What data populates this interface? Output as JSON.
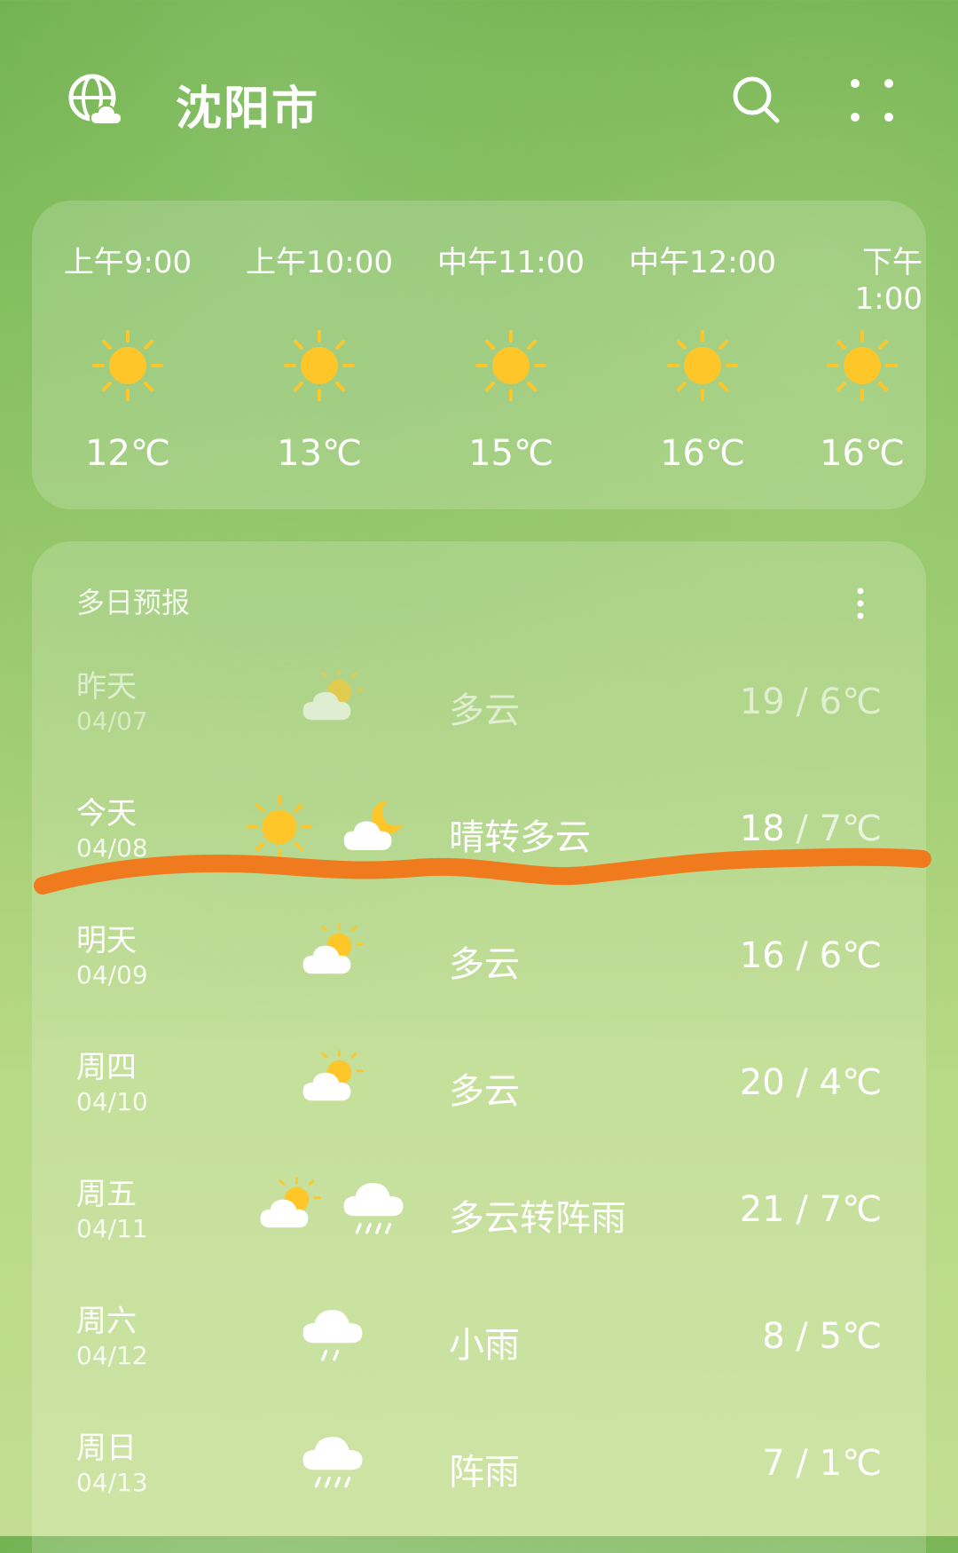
{
  "header": {
    "city": "沈阳市",
    "icons": {
      "left": "globe-cloud-icon",
      "search": "search-icon",
      "more": "more-dots-icon"
    }
  },
  "hourly": [
    {
      "time": "上午9:00",
      "temp": "12℃",
      "icon": "sun-icon"
    },
    {
      "time": "上午10:00",
      "temp": "13℃",
      "icon": "sun-icon"
    },
    {
      "time": "中午11:00",
      "temp": "15℃",
      "icon": "sun-icon"
    },
    {
      "time": "中午12:00",
      "temp": "16℃",
      "icon": "sun-icon"
    },
    {
      "time": "下午1:00",
      "temp": "16℃",
      "icon": "sun-icon"
    }
  ],
  "daily": {
    "title": "多日预报",
    "items": [
      {
        "day": "昨天",
        "date": "04/07",
        "condition": "多云",
        "temp_hi": "19",
        "temp_lo": "6℃",
        "icons": [
          "partly-cloudy-icon"
        ]
      },
      {
        "day": "今天",
        "date": "04/08",
        "condition": "晴转多云",
        "temp_hi": "18",
        "temp_lo": "7℃",
        "icons": [
          "sun-icon",
          "cloud-moon-icon"
        ]
      },
      {
        "day": "明天",
        "date": "04/09",
        "condition": "多云",
        "temp_hi": "16",
        "temp_lo": "6℃",
        "icons": [
          "partly-cloudy-icon"
        ]
      },
      {
        "day": "周四",
        "date": "04/10",
        "condition": "多云",
        "temp_hi": "20",
        "temp_lo": "4℃",
        "icons": [
          "partly-cloudy-icon"
        ]
      },
      {
        "day": "周五",
        "date": "04/11",
        "condition": "多云转阵雨",
        "temp_hi": "21",
        "temp_lo": "7℃",
        "icons": [
          "partly-cloudy-icon",
          "rain-cloud-icon"
        ]
      },
      {
        "day": "周六",
        "date": "04/12",
        "condition": "小雨",
        "temp_hi": "8",
        "temp_lo": "5℃",
        "icons": [
          "light-rain-icon"
        ]
      },
      {
        "day": "周日",
        "date": "04/13",
        "condition": "阵雨",
        "temp_hi": "7",
        "temp_lo": "1℃",
        "icons": [
          "rain-cloud-icon"
        ]
      }
    ]
  },
  "colors": {
    "sun": "#ffc62a",
    "annotation": "#f07b1e",
    "text": "#ffffff"
  }
}
